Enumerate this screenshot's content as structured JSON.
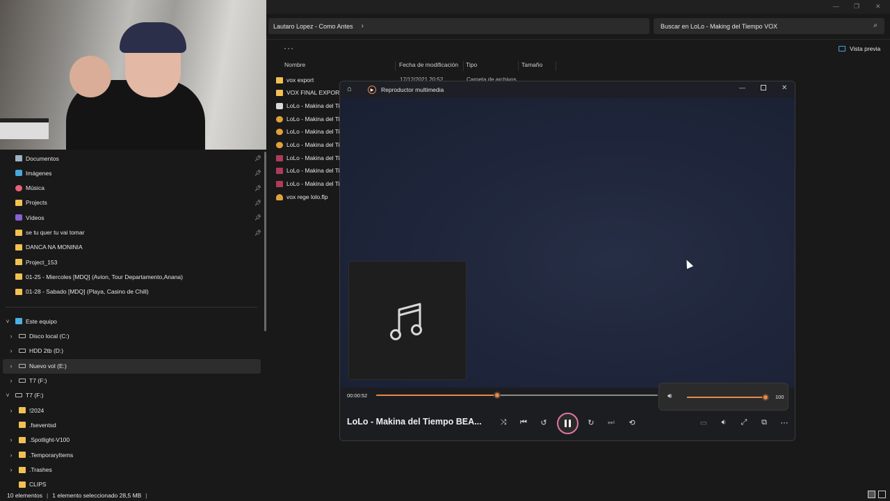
{
  "explorer": {
    "breadcrumb": "Lautaro Lopez - Como Antes",
    "breadcrumb_chevron": "›",
    "search_placeholder": "Buscar en LoLo - Making del Tiempo VOX",
    "more_label": "···",
    "preview_label": "Vista previa",
    "columns": [
      "Nombre",
      "Fecha de modificación",
      "Tipo",
      "Tamaño"
    ],
    "files": [
      {
        "name": "vox export",
        "icon": "folder",
        "date": "17/12/2021 20:52",
        "type": "Carpeta de archivos"
      },
      {
        "name": "VOX FINAL EXPORT S",
        "icon": "folder"
      },
      {
        "name": "LoLo - Makina del Tie",
        "icon": "wav"
      },
      {
        "name": "LoLo - Makina del Tie",
        "icon": "mp3"
      },
      {
        "name": "LoLo - Makina del Tie",
        "icon": "mp3"
      },
      {
        "name": "LoLo - Makina del Tie",
        "icon": "mp3"
      },
      {
        "name": "LoLo - Makina del Tie",
        "icon": "rar"
      },
      {
        "name": "LoLo - Makina del Tie",
        "icon": "rar"
      },
      {
        "name": "LoLo - Makina del Tie",
        "icon": "rar"
      },
      {
        "name": "vox rege lolo.flp",
        "icon": "flp"
      }
    ],
    "quick_access": [
      {
        "label": "Documentos",
        "icon": "doc",
        "pinned": true
      },
      {
        "label": "Imágenes",
        "icon": "img",
        "pinned": true
      },
      {
        "label": "Música",
        "icon": "music",
        "pinned": true
      },
      {
        "label": "Projects",
        "icon": "folder",
        "pinned": true
      },
      {
        "label": "Vídeos",
        "icon": "video",
        "pinned": true
      },
      {
        "label": "se tu quer tu vai tomar",
        "icon": "folder",
        "pinned": true
      },
      {
        "label": "DANCA NA MONINIA",
        "icon": "folder",
        "pinned": false
      },
      {
        "label": "Project_153",
        "icon": "folder",
        "pinned": false
      },
      {
        "label": "01-25 - Miercoles [MDQ] (Avion, Tour Departamento,Anana)",
        "icon": "folder",
        "pinned": false
      },
      {
        "label": "01-28 - Sabado [MDQ] (Playa, Casino de Chill)",
        "icon": "folder",
        "pinned": false
      }
    ],
    "tree": [
      {
        "label": "Este equipo",
        "icon": "pc",
        "chevron": "˅",
        "indent": 0
      },
      {
        "label": "Disco local (C:)",
        "icon": "drive",
        "chevron": "›",
        "indent": 1
      },
      {
        "label": "HDD 2tb (D:)",
        "icon": "drive",
        "chevron": "›",
        "indent": 1
      },
      {
        "label": "Nuevo vol (E:)",
        "icon": "drive",
        "chevron": "›",
        "indent": 1,
        "selected": true
      },
      {
        "label": "T7 (F:)",
        "icon": "drive",
        "chevron": "›",
        "indent": 1
      },
      {
        "label": "T7 (F:)",
        "icon": "drive",
        "chevron": "˅",
        "indent": 0
      },
      {
        "label": "!2024",
        "icon": "folder",
        "chevron": "›",
        "indent": 1
      },
      {
        "label": ".fseventsd",
        "icon": "folder",
        "chevron": "",
        "indent": 1
      },
      {
        "label": ".Spotlight-V100",
        "icon": "folder",
        "chevron": "›",
        "indent": 1
      },
      {
        "label": ".TemporaryItems",
        "icon": "folder",
        "chevron": "›",
        "indent": 1
      },
      {
        "label": ".Trashes",
        "icon": "folder",
        "chevron": "›",
        "indent": 1
      },
      {
        "label": "CLIPS",
        "icon": "folder",
        "chevron": "",
        "indent": 1
      }
    ],
    "status": {
      "count": "10 elementos",
      "selection": "1 elemento seleccionado  28,5 MB"
    }
  },
  "player": {
    "app_title": "Reproductor multimedia",
    "home_icon": "home-icon",
    "elapsed": "00:00:52",
    "progress_fraction": 0.43,
    "volume": 100,
    "volume_label": "100",
    "track_title": "LoLo - Makina del Tiempo BEA...",
    "accent": "#e88a4a",
    "album_placeholder_icon": "music-note-icon"
  }
}
